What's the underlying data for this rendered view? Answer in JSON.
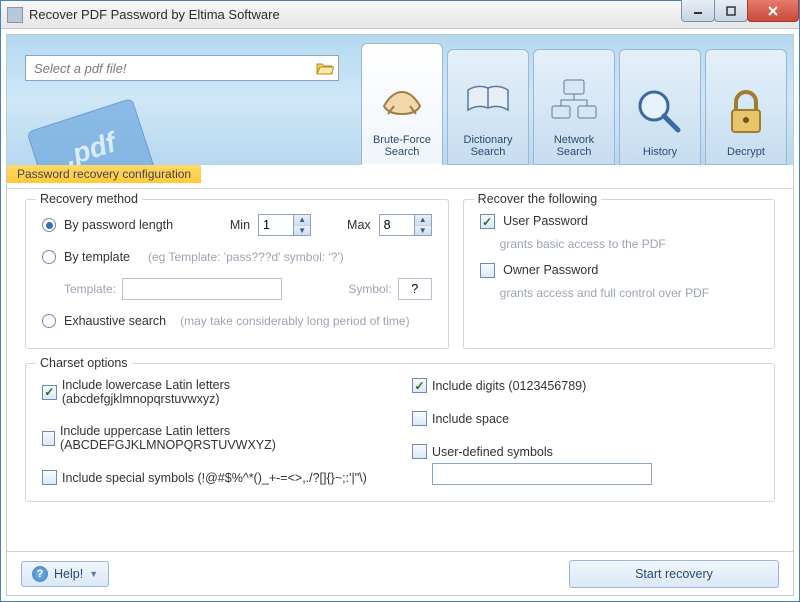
{
  "window": {
    "title": "Recover PDF Password by Eltima Software"
  },
  "filebox": {
    "placeholder": "Select a pdf file!"
  },
  "tabs": [
    {
      "id": "brute",
      "label": "Brute-Force\nSearch",
      "active": true
    },
    {
      "id": "dict",
      "label": "Dictionary\nSearch",
      "active": false
    },
    {
      "id": "net",
      "label": "Network\nSearch",
      "active": false
    },
    {
      "id": "history",
      "label": "History",
      "active": false
    },
    {
      "id": "decrypt",
      "label": "Decrypt",
      "active": false
    }
  ],
  "config_label": "Password recovery configuration",
  "recovery_method": {
    "legend": "Recovery method",
    "by_length": {
      "label": "By password length",
      "min_label": "Min",
      "min_value": "1",
      "max_label": "Max",
      "max_value": "8",
      "selected": true
    },
    "by_template": {
      "label": "By template",
      "hint": "(eg Template: 'pass???d' symbol: '?')",
      "template_label": "Template:",
      "template_value": "",
      "symbol_label": "Symbol:",
      "symbol_value": "?",
      "selected": false
    },
    "exhaustive": {
      "label": "Exhaustive search",
      "hint": "(may take considerably long period of time)",
      "selected": false
    }
  },
  "recover_following": {
    "legend": "Recover the following",
    "user": {
      "label": "User Password",
      "hint": "grants basic access to the PDF",
      "checked": true
    },
    "owner": {
      "label": "Owner Password",
      "hint": "grants access and full control over PDF",
      "checked": false
    }
  },
  "charset": {
    "legend": "Charset options",
    "lowercase": {
      "label": "Include lowercase Latin letters (abcdefgjklmnopqrstuvwxyz)",
      "checked": true
    },
    "uppercase": {
      "label": "Include uppercase Latin letters (ABCDEFGJKLMNOPQRSTUVWXYZ)",
      "checked": false
    },
    "special": {
      "label": "Include special symbols (!@#$%^*()_+-=<>,./?[]{}~;:'|\"\\)",
      "checked": false
    },
    "digits": {
      "label": "Include digits (0123456789)",
      "checked": true
    },
    "space": {
      "label": "Include space",
      "checked": false
    },
    "user_defined": {
      "label": "User-defined symbols",
      "checked": false,
      "value": ""
    }
  },
  "buttons": {
    "help": "Help!",
    "start": "Start recovery"
  }
}
